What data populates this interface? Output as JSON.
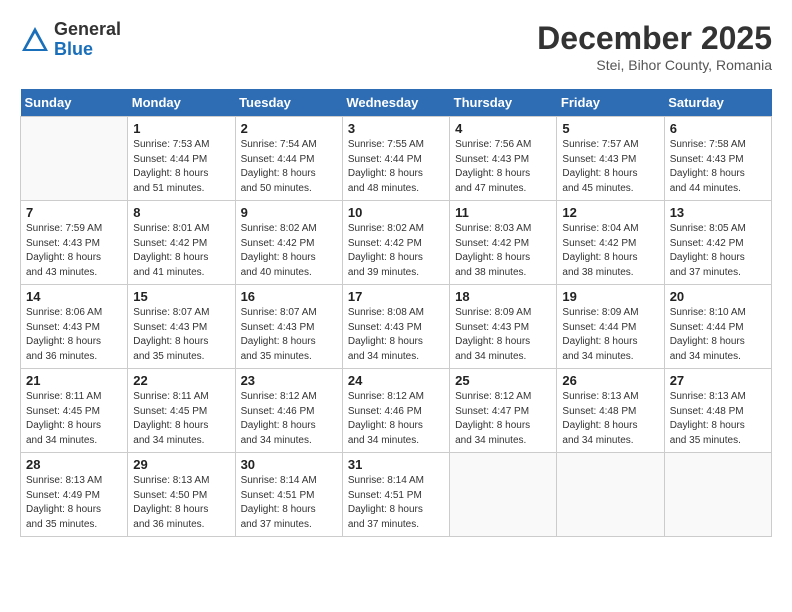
{
  "header": {
    "logo_general": "General",
    "logo_blue": "Blue",
    "month": "December 2025",
    "location": "Stei, Bihor County, Romania"
  },
  "days_of_week": [
    "Sunday",
    "Monday",
    "Tuesday",
    "Wednesday",
    "Thursday",
    "Friday",
    "Saturday"
  ],
  "weeks": [
    [
      {
        "day": "",
        "info": ""
      },
      {
        "day": "1",
        "info": "Sunrise: 7:53 AM\nSunset: 4:44 PM\nDaylight: 8 hours\nand 51 minutes."
      },
      {
        "day": "2",
        "info": "Sunrise: 7:54 AM\nSunset: 4:44 PM\nDaylight: 8 hours\nand 50 minutes."
      },
      {
        "day": "3",
        "info": "Sunrise: 7:55 AM\nSunset: 4:44 PM\nDaylight: 8 hours\nand 48 minutes."
      },
      {
        "day": "4",
        "info": "Sunrise: 7:56 AM\nSunset: 4:43 PM\nDaylight: 8 hours\nand 47 minutes."
      },
      {
        "day": "5",
        "info": "Sunrise: 7:57 AM\nSunset: 4:43 PM\nDaylight: 8 hours\nand 45 minutes."
      },
      {
        "day": "6",
        "info": "Sunrise: 7:58 AM\nSunset: 4:43 PM\nDaylight: 8 hours\nand 44 minutes."
      }
    ],
    [
      {
        "day": "7",
        "info": "Sunrise: 7:59 AM\nSunset: 4:43 PM\nDaylight: 8 hours\nand 43 minutes."
      },
      {
        "day": "8",
        "info": "Sunrise: 8:01 AM\nSunset: 4:42 PM\nDaylight: 8 hours\nand 41 minutes."
      },
      {
        "day": "9",
        "info": "Sunrise: 8:02 AM\nSunset: 4:42 PM\nDaylight: 8 hours\nand 40 minutes."
      },
      {
        "day": "10",
        "info": "Sunrise: 8:02 AM\nSunset: 4:42 PM\nDaylight: 8 hours\nand 39 minutes."
      },
      {
        "day": "11",
        "info": "Sunrise: 8:03 AM\nSunset: 4:42 PM\nDaylight: 8 hours\nand 38 minutes."
      },
      {
        "day": "12",
        "info": "Sunrise: 8:04 AM\nSunset: 4:42 PM\nDaylight: 8 hours\nand 38 minutes."
      },
      {
        "day": "13",
        "info": "Sunrise: 8:05 AM\nSunset: 4:42 PM\nDaylight: 8 hours\nand 37 minutes."
      }
    ],
    [
      {
        "day": "14",
        "info": "Sunrise: 8:06 AM\nSunset: 4:43 PM\nDaylight: 8 hours\nand 36 minutes."
      },
      {
        "day": "15",
        "info": "Sunrise: 8:07 AM\nSunset: 4:43 PM\nDaylight: 8 hours\nand 35 minutes."
      },
      {
        "day": "16",
        "info": "Sunrise: 8:07 AM\nSunset: 4:43 PM\nDaylight: 8 hours\nand 35 minutes."
      },
      {
        "day": "17",
        "info": "Sunrise: 8:08 AM\nSunset: 4:43 PM\nDaylight: 8 hours\nand 34 minutes."
      },
      {
        "day": "18",
        "info": "Sunrise: 8:09 AM\nSunset: 4:43 PM\nDaylight: 8 hours\nand 34 minutes."
      },
      {
        "day": "19",
        "info": "Sunrise: 8:09 AM\nSunset: 4:44 PM\nDaylight: 8 hours\nand 34 minutes."
      },
      {
        "day": "20",
        "info": "Sunrise: 8:10 AM\nSunset: 4:44 PM\nDaylight: 8 hours\nand 34 minutes."
      }
    ],
    [
      {
        "day": "21",
        "info": "Sunrise: 8:11 AM\nSunset: 4:45 PM\nDaylight: 8 hours\nand 34 minutes."
      },
      {
        "day": "22",
        "info": "Sunrise: 8:11 AM\nSunset: 4:45 PM\nDaylight: 8 hours\nand 34 minutes."
      },
      {
        "day": "23",
        "info": "Sunrise: 8:12 AM\nSunset: 4:46 PM\nDaylight: 8 hours\nand 34 minutes."
      },
      {
        "day": "24",
        "info": "Sunrise: 8:12 AM\nSunset: 4:46 PM\nDaylight: 8 hours\nand 34 minutes."
      },
      {
        "day": "25",
        "info": "Sunrise: 8:12 AM\nSunset: 4:47 PM\nDaylight: 8 hours\nand 34 minutes."
      },
      {
        "day": "26",
        "info": "Sunrise: 8:13 AM\nSunset: 4:48 PM\nDaylight: 8 hours\nand 34 minutes."
      },
      {
        "day": "27",
        "info": "Sunrise: 8:13 AM\nSunset: 4:48 PM\nDaylight: 8 hours\nand 35 minutes."
      }
    ],
    [
      {
        "day": "28",
        "info": "Sunrise: 8:13 AM\nSunset: 4:49 PM\nDaylight: 8 hours\nand 35 minutes."
      },
      {
        "day": "29",
        "info": "Sunrise: 8:13 AM\nSunset: 4:50 PM\nDaylight: 8 hours\nand 36 minutes."
      },
      {
        "day": "30",
        "info": "Sunrise: 8:14 AM\nSunset: 4:51 PM\nDaylight: 8 hours\nand 37 minutes."
      },
      {
        "day": "31",
        "info": "Sunrise: 8:14 AM\nSunset: 4:51 PM\nDaylight: 8 hours\nand 37 minutes."
      },
      {
        "day": "",
        "info": ""
      },
      {
        "day": "",
        "info": ""
      },
      {
        "day": "",
        "info": ""
      }
    ]
  ]
}
